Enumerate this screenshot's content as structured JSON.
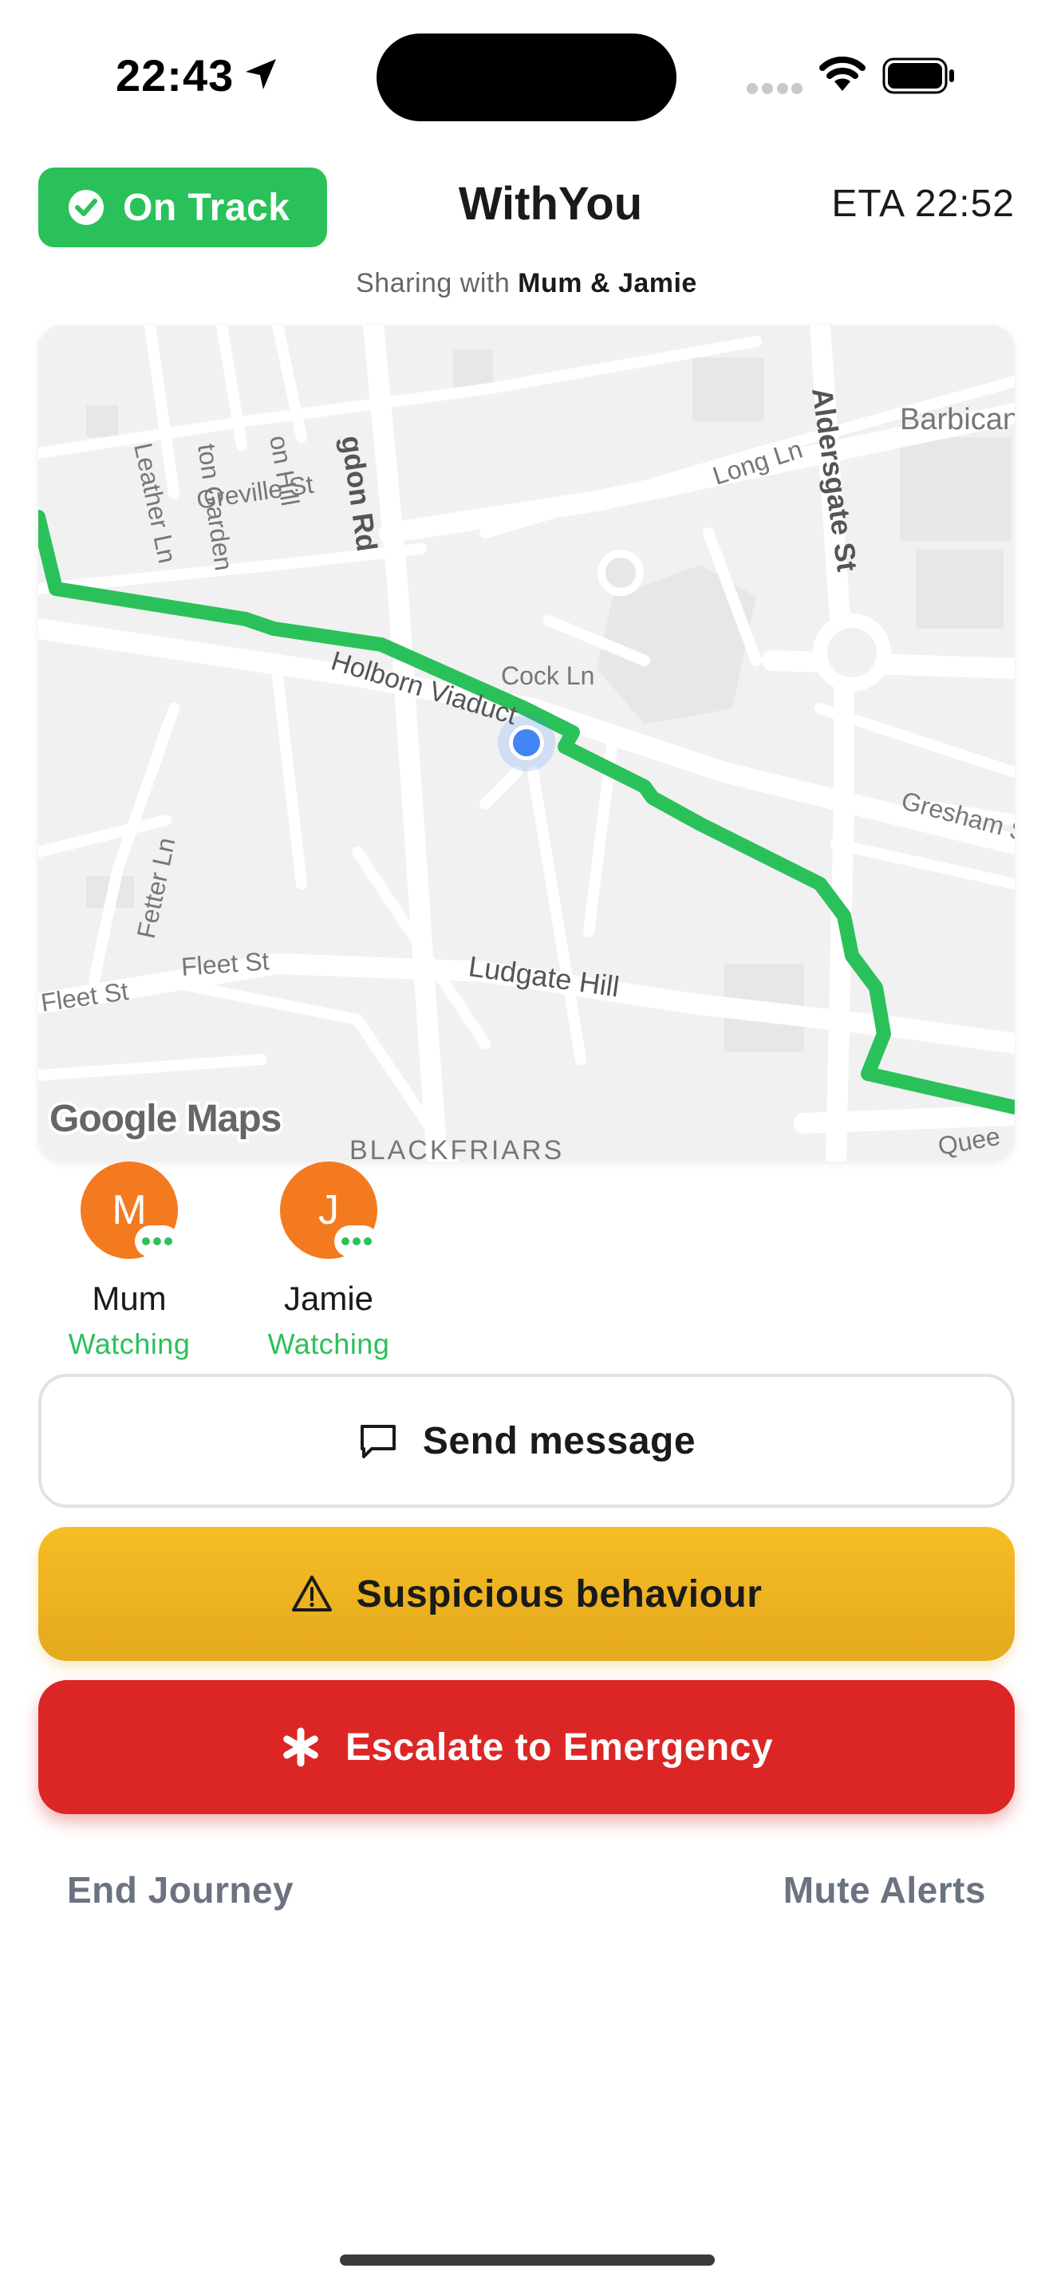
{
  "status_bar": {
    "time": "22:43"
  },
  "header": {
    "status_pill": "On Track",
    "title": "WithYou",
    "eta": "ETA 22:52",
    "sharing_prefix": "Sharing with ",
    "sharing_names": "Mum & Jamie"
  },
  "map": {
    "attribution": "Google Maps",
    "streets": [
      "Leather Ln",
      "ton Garden",
      "on Hill",
      "gdon Rd",
      "Greville St",
      "Long Ln",
      "Aldersgate St",
      "Barbican",
      "Holborn Viaduct",
      "Cock Ln",
      "Gresham S",
      "Fetter Ln",
      "Fleet St",
      "Fleet St",
      "Ludgate Hill",
      "BLACKFRIARS",
      "Quee"
    ],
    "route_color": "#2bc15a",
    "location_color": "#4285f4"
  },
  "watchers": [
    {
      "initial": "M",
      "name": "Mum",
      "status": "Watching"
    },
    {
      "initial": "J",
      "name": "Jamie",
      "status": "Watching"
    }
  ],
  "actions": {
    "message": "Send message",
    "suspicious": "Suspicious behaviour",
    "emergency": "Escalate to Emergency"
  },
  "footer": {
    "end": "End Journey",
    "mute": "Mute Alerts"
  },
  "colors": {
    "green": "#2bc15a",
    "amber": "#f6bd25",
    "red": "#dc2626",
    "orange": "#f47a20"
  }
}
